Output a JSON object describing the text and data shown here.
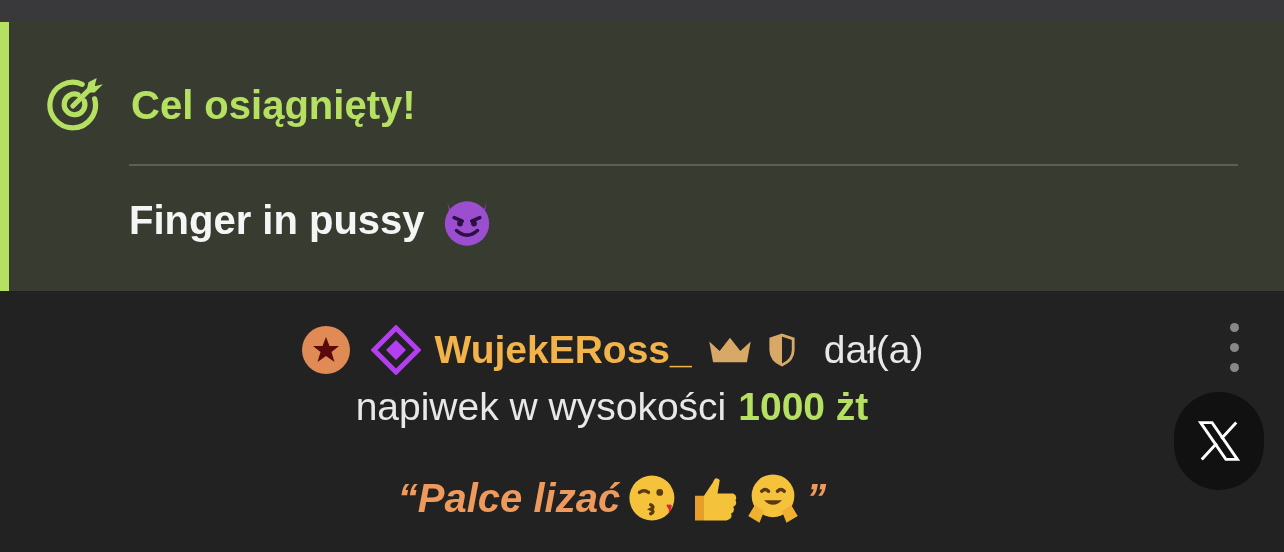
{
  "goal": {
    "title": "Cel osiągnięty!",
    "description": "Finger in pussy"
  },
  "tip": {
    "username": "WujekERoss_",
    "verb": "dał(a)",
    "amount_prefix": "napiwek w wysokości",
    "amount": "1000 żt",
    "message_open": "“Palce lizać",
    "message_close": "”"
  }
}
